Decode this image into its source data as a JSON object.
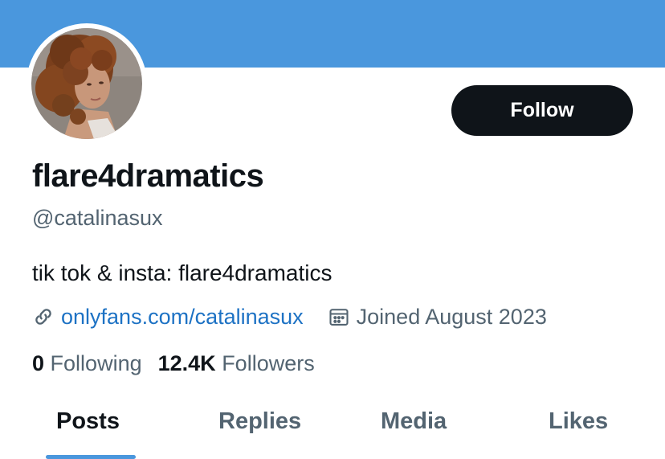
{
  "profile": {
    "display_name": "flare4dramatics",
    "handle": "@catalinasux",
    "bio": "tik tok & insta: flare4dramatics",
    "link": "onlyfans.com/catalinasux",
    "joined": "Joined August 2023",
    "following_count": "0",
    "following_label": "Following",
    "followers_count": "12.4K",
    "followers_label": "Followers"
  },
  "actions": {
    "follow_label": "Follow"
  },
  "tabs": [
    {
      "label": "Posts",
      "active": true
    },
    {
      "label": "Replies",
      "active": false
    },
    {
      "label": "Media",
      "active": false
    },
    {
      "label": "Likes",
      "active": false
    }
  ],
  "icons": {
    "link": "link-icon",
    "calendar": "calendar-icon"
  },
  "colors": {
    "banner": "#4a97dd",
    "link": "#1d72c4",
    "follow_button": "#0f1419",
    "muted_text": "#536471",
    "tab_indicator": "#4a97dd"
  }
}
